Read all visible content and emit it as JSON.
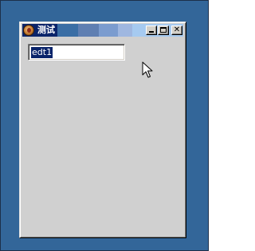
{
  "window": {
    "title": "测试",
    "controls": {
      "minimize_icon": "minimize-icon",
      "maximize_icon": "maximize-icon",
      "close_icon": "close-icon"
    },
    "app_icon": "app-icon"
  },
  "edit_field": {
    "value": "edt1",
    "selected": true
  },
  "colors": {
    "desktop": "#336699",
    "window_face": "#d0d0d0",
    "titlebar_active": "#0a246a",
    "selection": "#0a246a"
  },
  "pointer": "arrow-cursor-icon"
}
